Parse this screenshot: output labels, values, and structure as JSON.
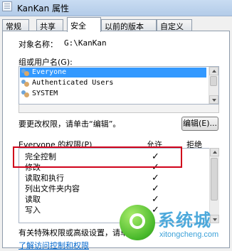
{
  "window": {
    "title": "KanKan 属性"
  },
  "tabs": [
    {
      "label": "常规"
    },
    {
      "label": "共享"
    },
    {
      "label": "安全"
    },
    {
      "label": "以前的版本"
    },
    {
      "label": "自定义"
    }
  ],
  "active_tab": "安全",
  "object": {
    "label": "对象名称：",
    "value": "G:\\KanKan"
  },
  "groups": {
    "label": "组或用户名(G):",
    "items": [
      {
        "name": "Everyone",
        "selected": true
      },
      {
        "name": "Authenticated Users",
        "selected": false
      },
      {
        "name": "SYSTEM",
        "selected": false
      }
    ]
  },
  "hint": "要更改权限，请单击“编辑”。",
  "edit_button": "编辑(E)...",
  "permissions": {
    "header": "Everyone 的权限(P)",
    "allow_header": "允许",
    "deny_header": "拒绝",
    "rows": [
      {
        "name": "完全控制",
        "allow": "✓"
      },
      {
        "name": "修改",
        "allow": "✓"
      },
      {
        "name": "读取和执行",
        "allow": "✓"
      },
      {
        "name": "列出文件夹内容",
        "allow": "✓"
      },
      {
        "name": "读取",
        "allow": "✓"
      },
      {
        "name": "写入",
        "allow": "✓"
      }
    ]
  },
  "footer_text": "有关特殊权限或高级设置，请单击",
  "link_text": "了解访问控制和权限",
  "watermark": {
    "big": "系统城",
    "sub": "xitongcheng.com"
  },
  "colors": {
    "highlight": "#3399ff",
    "red_box": "#d0021b",
    "link": "#0066cc",
    "watermark": "#3aa0d8"
  }
}
